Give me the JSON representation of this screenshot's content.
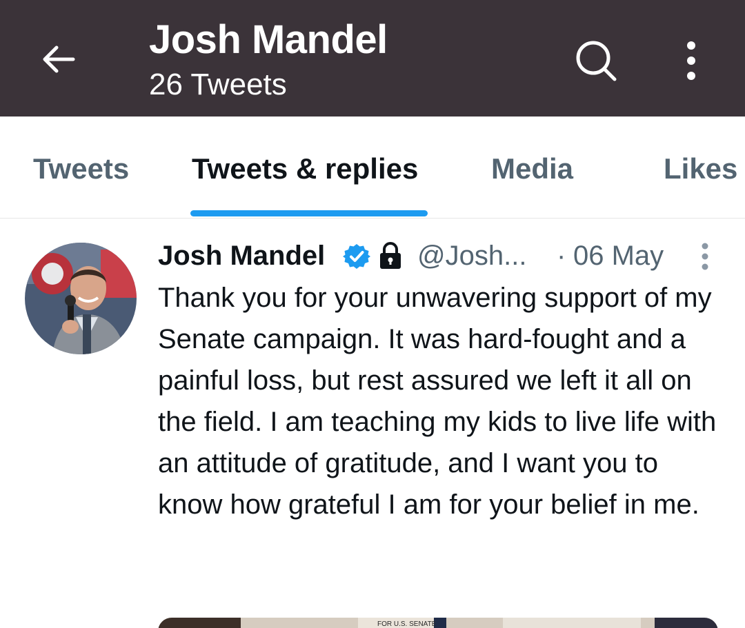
{
  "header": {
    "title": "Josh Mandel",
    "subtitle": "26 Tweets",
    "back_icon": "arrow-left-icon",
    "search_icon": "search-icon",
    "more_icon": "more-vertical-icon",
    "bg_color": "#3b3339"
  },
  "tabs": [
    {
      "label": "Tweets",
      "active": false
    },
    {
      "label": "Tweets & replies",
      "active": true
    },
    {
      "label": "Media",
      "active": false
    },
    {
      "label": "Likes",
      "active": false
    }
  ],
  "accent_color": "#1d9bf0",
  "tweet": {
    "author_name": "Josh Mandel",
    "handle": "@Josh...",
    "separator": "·",
    "date": "06 May",
    "verified_icon": "verified-badge-icon",
    "protected_icon": "lock-icon",
    "text": "Thank you for your unwavering support of my Senate campaign. It was hard-fought and a painful loss, but rest assured we left it all on the field. I am teaching my kids to live life with an attitude of gratitude, and I want you to know how grateful I am for your belief in me.",
    "media_caption": "FOR U.S. SENATE"
  }
}
